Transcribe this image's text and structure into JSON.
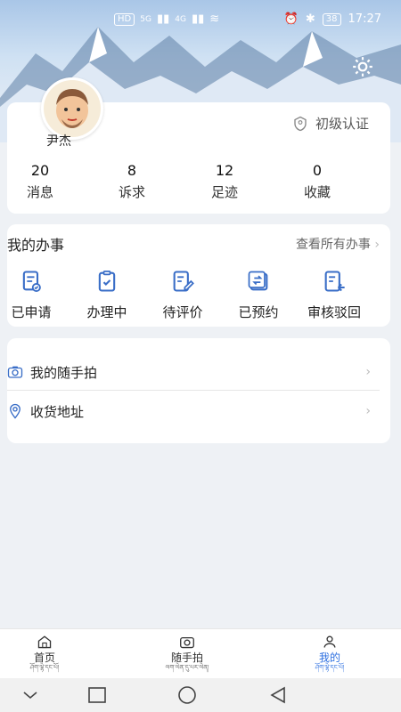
{
  "status_bar": {
    "hd1": "HD",
    "hd2": "HD",
    "signal_5g": "5G",
    "signal_4g": "4G",
    "battery": "38",
    "time": "17:27"
  },
  "profile": {
    "username": "尹杰",
    "auth_label": "初级认证",
    "stats": [
      {
        "value": "20",
        "label": "消息"
      },
      {
        "value": "8",
        "label": "诉求"
      },
      {
        "value": "12",
        "label": "足迹"
      },
      {
        "value": "0",
        "label": "收藏"
      }
    ]
  },
  "services": {
    "title": "我的办事",
    "view_all": "查看所有办事",
    "items": [
      {
        "label": "已申请",
        "icon": "file-check-icon"
      },
      {
        "label": "办理中",
        "icon": "clipboard-check-icon"
      },
      {
        "label": "待评价",
        "icon": "edit-doc-icon"
      },
      {
        "label": "已预约",
        "icon": "calendar-sync-icon"
      },
      {
        "label": "审核驳回",
        "icon": "return-doc-icon"
      }
    ]
  },
  "menu": [
    {
      "label": "我的随手拍",
      "icon": "camera-icon"
    },
    {
      "label": "收货地址",
      "icon": "location-icon"
    }
  ],
  "tabbar": [
    {
      "label": "首页",
      "sub": "ཤོག་ལྷེ་དང་པོ།",
      "icon": "home-icon"
    },
    {
      "label": "随手拍",
      "sub": "ལག་ལེན་དུ་པར་ལེན།",
      "icon": "camera-icon"
    },
    {
      "label": "我的",
      "sub": "ཤོག་ལྷེ་དང་པོ།",
      "icon": "user-icon",
      "active": true
    }
  ],
  "colors": {
    "accent": "#2d6fe0",
    "icon_blue": "#3a6ec7"
  }
}
